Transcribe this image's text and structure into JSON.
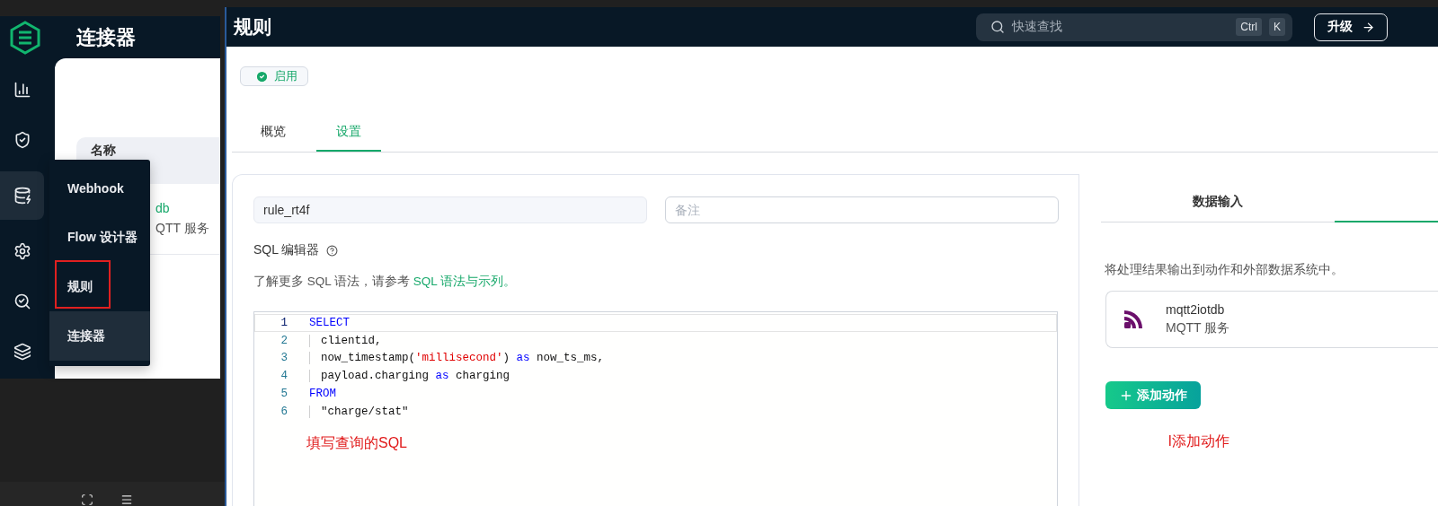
{
  "connector_window": {
    "title": "连接器",
    "sidebar": [
      {
        "selected": false
      },
      {
        "selected": false
      },
      {
        "selected": true
      },
      {
        "selected": false
      },
      {
        "selected": false
      },
      {
        "selected": false
      }
    ],
    "table": {
      "columns": [
        "名称"
      ],
      "rows": [
        {
          "name": "db",
          "type": "QTT 服务"
        }
      ]
    },
    "flyout_menu": [
      {
        "label": "Webhook",
        "selected": false,
        "annotated": false
      },
      {
        "label": "Flow 设计器",
        "selected": false,
        "annotated": false
      },
      {
        "label": "规则",
        "selected": false,
        "annotated": true
      },
      {
        "label": "连接器",
        "selected": true,
        "annotated": false
      }
    ]
  },
  "rule_window": {
    "title": "规则",
    "search": {
      "placeholder": "快速查找",
      "keys": [
        "Ctrl",
        "K"
      ]
    },
    "upgrade_button": "升级",
    "status": {
      "label": "启用",
      "on": true
    },
    "tabs": [
      {
        "label": "概览",
        "selected": false
      },
      {
        "label": "设置",
        "selected": true
      }
    ],
    "name_field": {
      "value": "rule_rt4f"
    },
    "note_field": {
      "placeholder": "备注"
    },
    "sql_label": "SQL 编辑器",
    "sql_hint": "了解更多 SQL 语法，请参考 ",
    "sql_link": "SQL 语法与示列。",
    "code_lines": [
      {
        "number": "1",
        "current": true,
        "indent": false,
        "tokens": [
          {
            "kind": "keyword",
            "text": "SELECT"
          }
        ]
      },
      {
        "number": "2",
        "current": false,
        "indent": true,
        "tokens": [
          {
            "kind": "plain",
            "text": "clientid,"
          }
        ]
      },
      {
        "number": "3",
        "current": false,
        "indent": true,
        "tokens": [
          {
            "kind": "plain",
            "text": "now_timestamp("
          },
          {
            "kind": "string",
            "text": "'millisecond'"
          },
          {
            "kind": "plain",
            "text": ") "
          },
          {
            "kind": "keyword",
            "text": "as"
          },
          {
            "kind": "plain",
            "text": " now_ts_ms,"
          }
        ]
      },
      {
        "number": "4",
        "current": false,
        "indent": true,
        "tokens": [
          {
            "kind": "plain",
            "text": "payload.charging "
          },
          {
            "kind": "keyword",
            "text": "as"
          },
          {
            "kind": "plain",
            "text": " charging"
          }
        ]
      },
      {
        "number": "5",
        "current": false,
        "indent": false,
        "tokens": [
          {
            "kind": "keyword",
            "text": "FROM"
          }
        ]
      },
      {
        "number": "6",
        "current": false,
        "indent": true,
        "tokens": [
          {
            "kind": "plain",
            "text": "\"charge/stat\""
          }
        ]
      }
    ],
    "editor_annotation": "填写查询的SQL",
    "output_tabs": [
      {
        "label": "数据输入",
        "selected": false
      },
      {
        "selected": true
      }
    ],
    "output_description": "将处理结果输出到动作和外部数据系统中。",
    "actions": [
      {
        "name": "mqtt2iotdb",
        "type": "MQTT 服务"
      }
    ],
    "add_action_button": "添加动作",
    "action_annotation": "l添加动作"
  }
}
